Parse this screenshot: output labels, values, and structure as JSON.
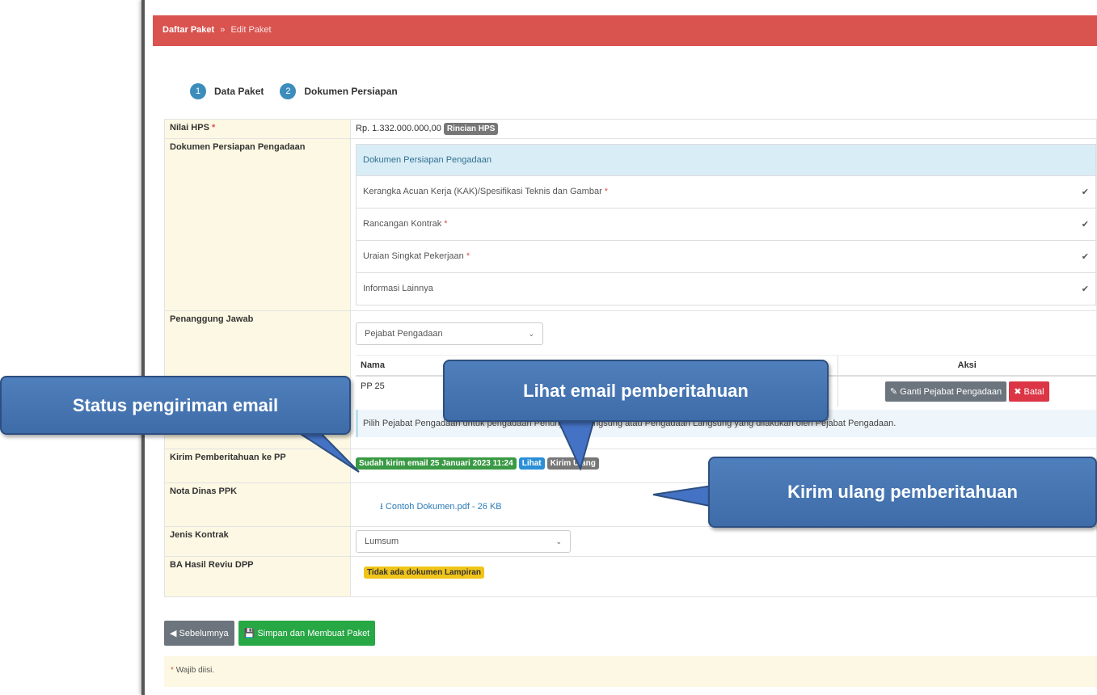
{
  "breadcrumb": {
    "root": "Daftar Paket",
    "sep": "»",
    "current": "Edit Paket"
  },
  "steps": [
    {
      "num": "1",
      "label": "Data Paket"
    },
    {
      "num": "2",
      "label": "Dokumen Persiapan"
    }
  ],
  "form": {
    "nilai_hps": {
      "label": "Nilai HPS",
      "req": "*",
      "value": "Rp. 1.332.000.000,00",
      "button": "Rincian HPS"
    },
    "dokumen": {
      "label": "Dokumen Persiapan Pengadaan",
      "header": "Dokumen Persiapan Pengadaan",
      "items": [
        {
          "text": "Kerangka Acuan Kerja (KAK)/Spesifikasi Teknis dan Gambar",
          "req": "*",
          "check": "✔"
        },
        {
          "text": "Rancangan Kontrak",
          "req": "*",
          "check": "✔"
        },
        {
          "text": "Uraian Singkat Pekerjaan",
          "req": "*",
          "check": "✔"
        },
        {
          "text": "Informasi Lainnya",
          "req": "",
          "check": "✔"
        }
      ]
    },
    "penanggung": {
      "label": "Penanggung Jawab",
      "select": "Pejabat Pengadaan",
      "col_nama": "Nama",
      "col_aksi": "Aksi",
      "row_nama": "PP 25",
      "btn_ganti": "Ganti Pejabat Pengadaan",
      "btn_batal": "Batal",
      "info": "Pilih Pejabat Pengadaan untuk pengadaan Penunjukan Langsung atau Pengadaan Langsung yang dilakukan oleh Pejabat Pengadaan."
    },
    "kirim": {
      "label": "Kirim Pemberitahuan ke PP",
      "status": "Sudah kirim email 25 Januari 2023 11:24",
      "lihat": "Lihat",
      "ulang": "Kirim Ulang"
    },
    "nota": {
      "label": "Nota Dinas PPK",
      "file": "Contoh Dokumen.pdf - 26 KB"
    },
    "jenis": {
      "label": "Jenis Kontrak",
      "select": "Lumsum"
    },
    "ba": {
      "label": "BA Hasil Reviu DPP",
      "status": "Tidak ada dokumen Lampiran"
    }
  },
  "buttons": {
    "prev": "Sebelumnya",
    "save": "Simpan dan Membuat Paket"
  },
  "note": {
    "star": "*",
    "text": "Wajib diisi."
  },
  "callouts": {
    "status": "Status pengiriman email",
    "lihat": "Lihat email pemberitahuan",
    "ulang": "Kirim ulang pemberitahuan"
  },
  "colors": {
    "header": "#d9534f",
    "callout": "#4472c4"
  }
}
